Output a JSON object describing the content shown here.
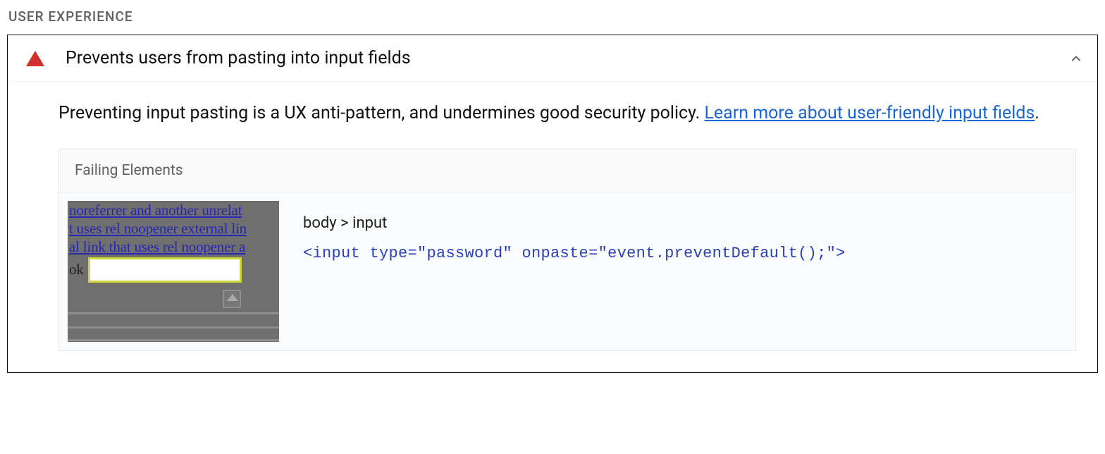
{
  "category": {
    "label": "USER EXPERIENCE"
  },
  "audit": {
    "title": "Prevents users from pasting into input fields",
    "description_prefix": "Preventing input pasting is a UX anti-pattern, and undermines good security policy. ",
    "link_text": "Learn more about user-friendly input fields",
    "description_suffix": ".",
    "table_header": "Failing Elements",
    "items": [
      {
        "node_path": "body > input",
        "snippet": "<input type=\"password\" onpaste=\"event.preventDefault();\">",
        "thumb": {
          "line1": " noreferrer and another unrelat",
          "line2": "t uses rel noopener external lin",
          "line3": "al link that uses rel noopener a",
          "ok_label": " ok"
        }
      }
    ]
  }
}
